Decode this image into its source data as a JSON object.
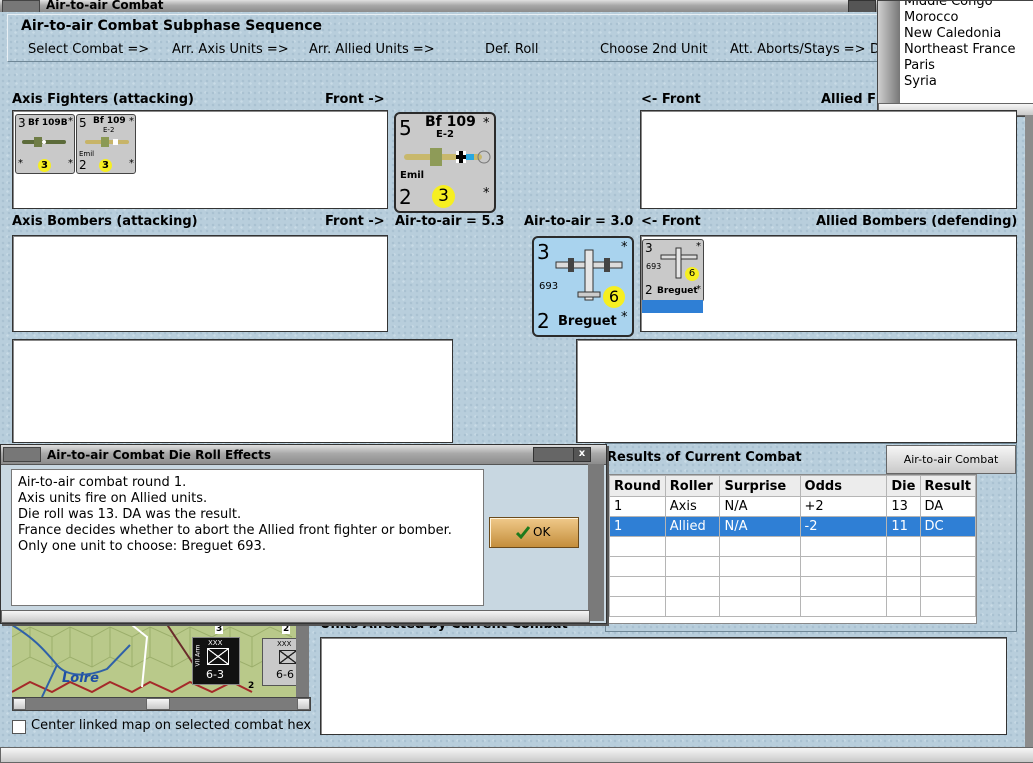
{
  "main_window": {
    "title": "Air-to-air Combat"
  },
  "sequence": {
    "title": "Air-to-air Combat Subphase Sequence",
    "steps": [
      "Select Combat =>",
      "Arr. Axis Units =>",
      "Arr. Allied Units =>",
      "Def. Roll",
      "Choose 2nd Unit",
      "Att. Aborts/Stays =>",
      "D"
    ]
  },
  "location_list": [
    "Middle Congo",
    "Morocco",
    "New Caledonia",
    "Northeast France",
    "Paris",
    "Syria"
  ],
  "labels": {
    "axis_fighters": "Axis Fighters (attacking)",
    "front_right": "Front ->",
    "front_left": "<- Front",
    "allied_fighters": "Allied F",
    "axis_bombers": "Axis Bombers (attacking)",
    "allied_bombers": "Allied Bombers (defending)",
    "axis_air_to_air": "Air-to-air = 5.3",
    "allied_air_to_air": "Air-to-air = 3.0"
  },
  "axis_fighters": [
    {
      "air_to_air": "3",
      "name": "Bf 109B",
      "range": "3",
      "star_tl": "*",
      "star_bl": "*",
      "star_br": "*"
    },
    {
      "air_to_air": "5",
      "name": "Bf 109",
      "sub": "E-2",
      "nickname": "Emil",
      "bottom": "2",
      "range": "3",
      "star_tl": "*",
      "star_br": "*"
    }
  ],
  "axis_front_counter": {
    "air_to_air": "5",
    "name": "Bf 109",
    "sub": "E-2",
    "nickname": "Emil",
    "bottom": "2",
    "range": "3",
    "star_tr": "*",
    "star_br": "*"
  },
  "allied_front_counter": {
    "air_to_air": "3",
    "number": "693",
    "range": "6",
    "bottom": "2",
    "name": "Breguet",
    "star_tr": "*",
    "star_br": "*"
  },
  "allied_bomber_small": {
    "air_to_air": "3",
    "number": "693",
    "range": "6",
    "bottom": "2",
    "name": "Breguet",
    "star_tr": "*",
    "star_br": "*"
  },
  "die_dialog": {
    "title": "Air-to-air Combat Die Roll Effects",
    "lines": [
      "Air-to-air combat round 1.",
      "Axis units fire on Allied units.",
      "Die roll was 13.  DA was the result.",
      "France decides whether to abort the Allied front fighter or bomber.",
      "Only one unit to choose: Breguet 693."
    ],
    "ok_label": "OK"
  },
  "results": {
    "title": "Results of Current Combat",
    "chart_button": "Air-to-air Combat Chart",
    "headers": [
      "Round",
      "Roller",
      "Surprise",
      "Odds",
      "Die",
      "Result"
    ],
    "rows": [
      [
        "1",
        "Axis",
        "N/A",
        "+2",
        "13",
        "DA"
      ],
      [
        "1",
        "Allied",
        "N/A",
        "-2",
        "11",
        "DC"
      ]
    ]
  },
  "units_affected": {
    "title": "Units Affected by Current Combat"
  },
  "map": {
    "river_label": "Loire",
    "unit_top": "XXX",
    "unit_side": "VII Arm",
    "unit_value": "6-3",
    "hex_numbers": [
      "3",
      "2",
      "2"
    ],
    "partial_top": "XXX",
    "partial_value": "6-6"
  },
  "center_checkbox": {
    "label": "Center linked map on selected combat hex",
    "checked": false
  },
  "colors": {
    "counter_blue": "#a9d3ee",
    "counter_grey": "#c9c9c9",
    "selection": "#2f7fd5",
    "ok_button": "#d6a455"
  }
}
